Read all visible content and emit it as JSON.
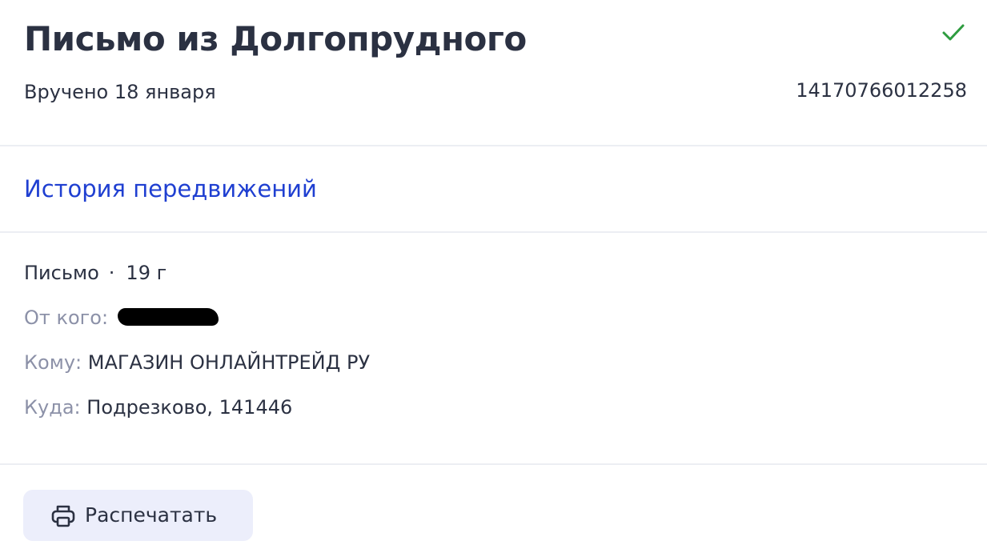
{
  "parcel": {
    "title": "Письмо из Долгопрудного",
    "status": "Вручено 18 января",
    "tracking_number": "14170766012258",
    "status_icon": "check-icon",
    "status_color": "#2e9c3f"
  },
  "history": {
    "link_label": "История передвижений",
    "link_color": "#1f3fd1"
  },
  "details": {
    "type": "Письмо",
    "separator": "·",
    "weight": "19 г",
    "from_label": "От кого:",
    "to_label": "Кому:",
    "to_value": "МАГАЗИН ОНЛАЙНТРЕЙД РУ",
    "where_label": "Куда:",
    "where_value": "Подрезково, 141446"
  },
  "actions": {
    "print_label": "Распечатать",
    "print_icon": "printer-icon"
  }
}
